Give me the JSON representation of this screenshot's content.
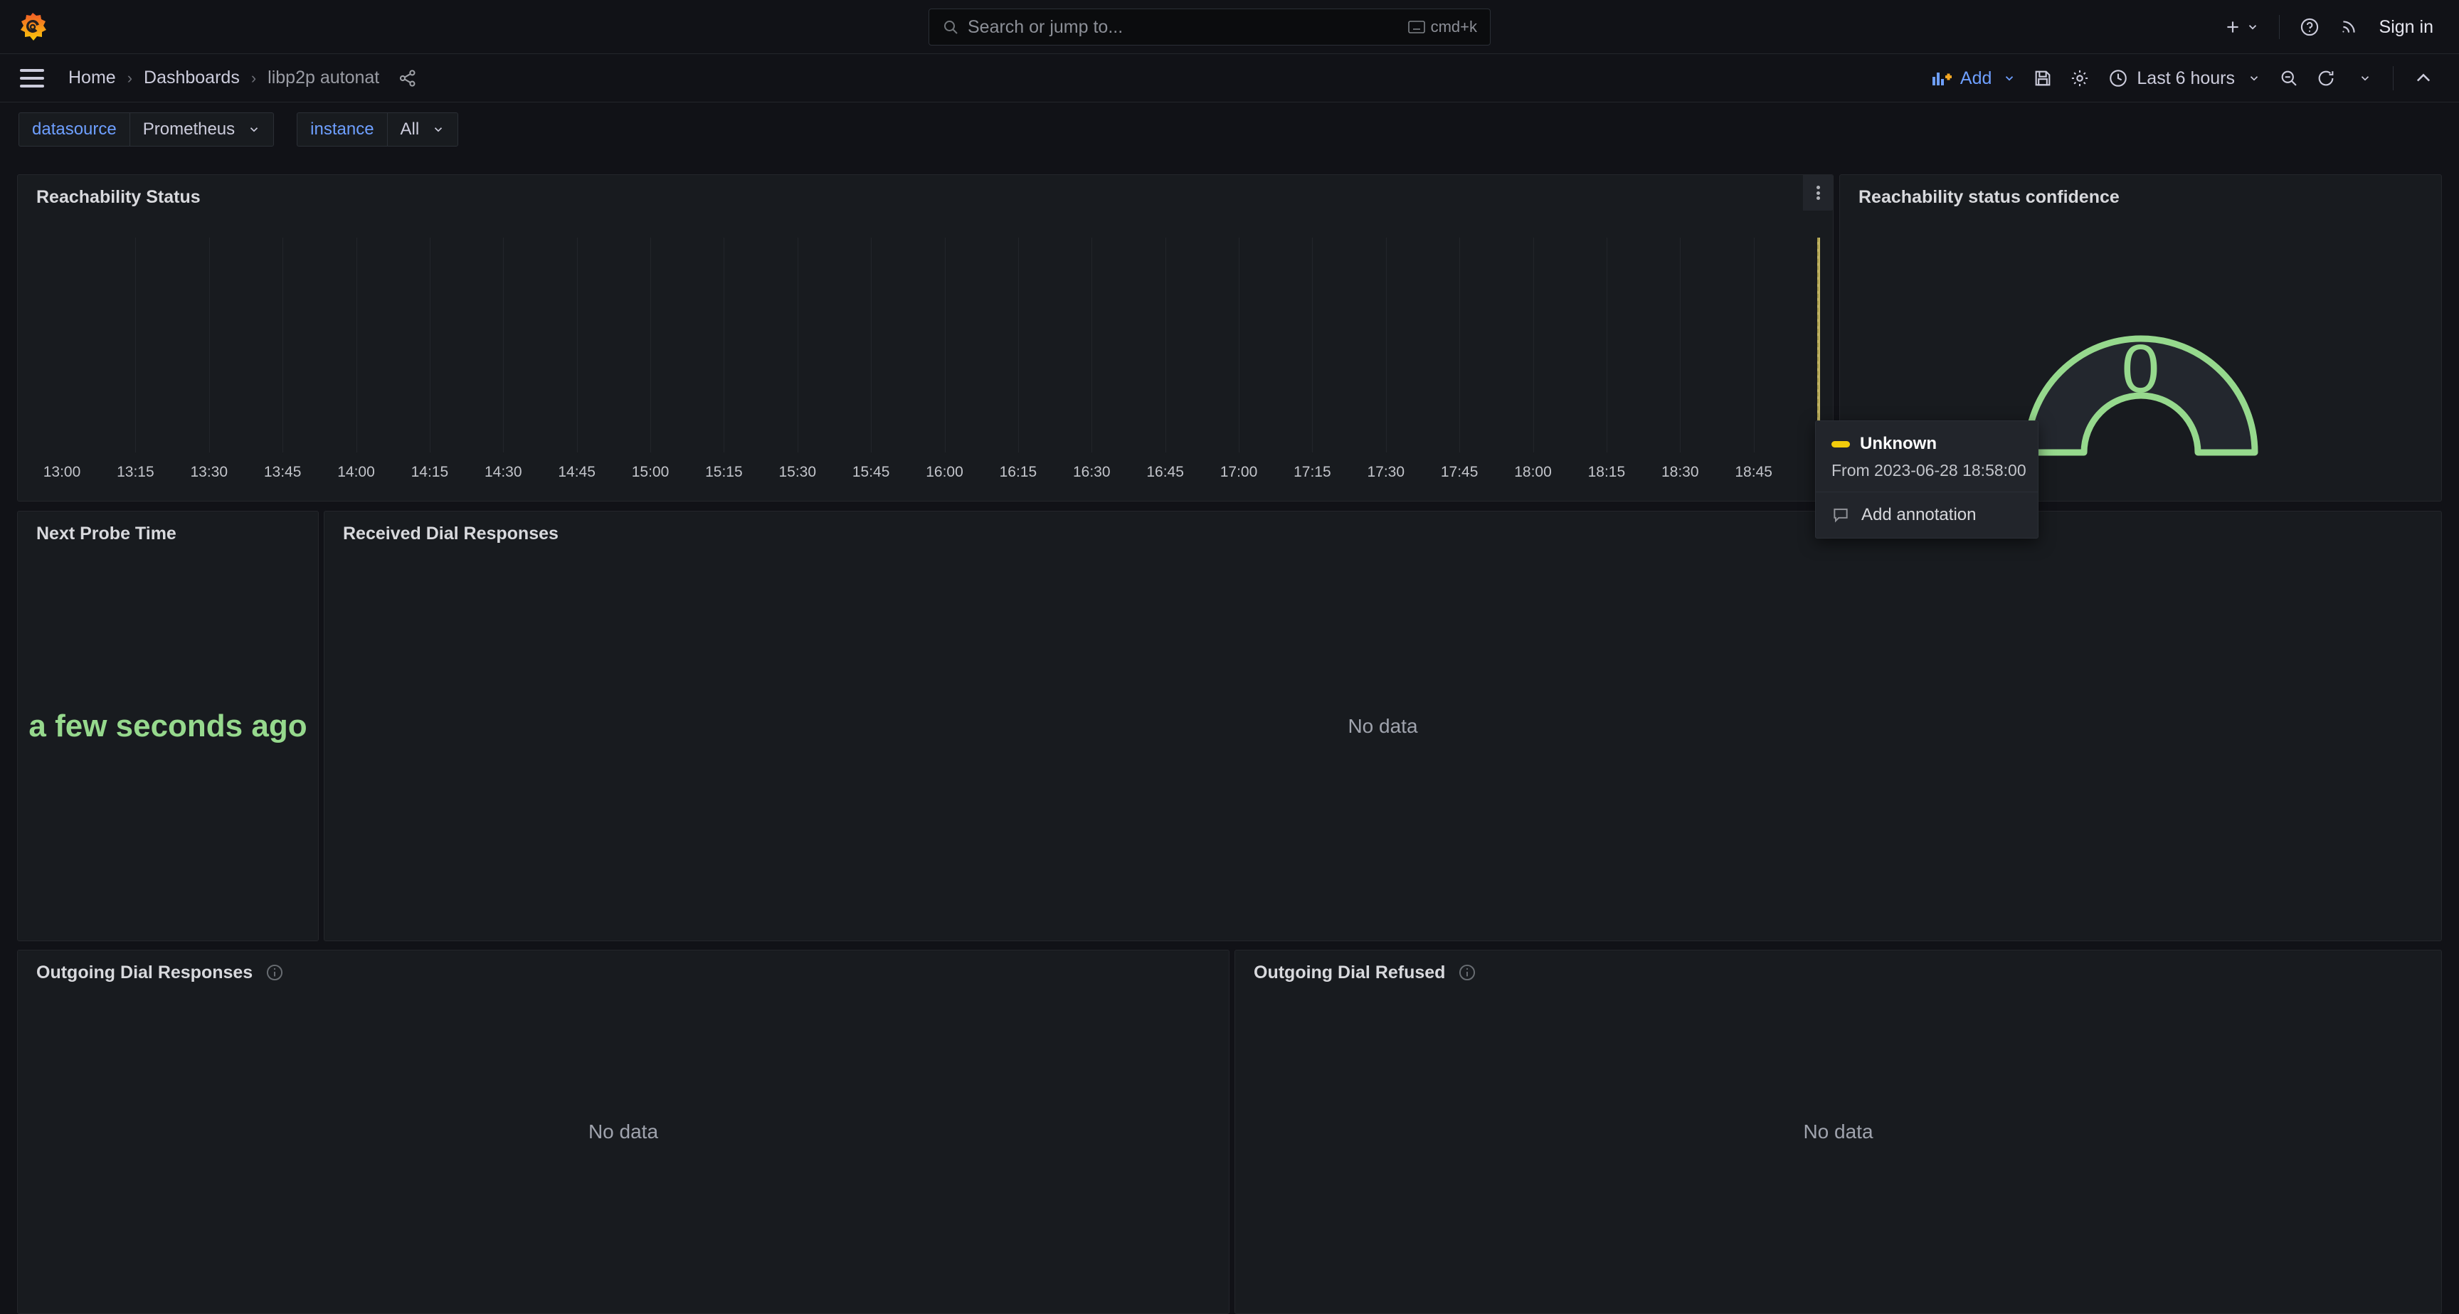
{
  "topbar": {
    "logo_name": "grafana-logo",
    "search": {
      "placeholder": "Search or jump to...",
      "shortcut": "cmd+k"
    },
    "add_new_label": "",
    "help_label": "",
    "news_label": "",
    "signin_label": "Sign in"
  },
  "subnav": {
    "breadcrumb": [
      {
        "label": "Home",
        "current": false
      },
      {
        "label": "Dashboards",
        "current": false
      },
      {
        "label": "libp2p autonat",
        "current": true
      }
    ],
    "breadcrumb_separator": "›",
    "add_label": "Add",
    "time_range_label": "Last 6 hours"
  },
  "variables": [
    {
      "name": "datasource",
      "value": "Prometheus"
    },
    {
      "name": "instance",
      "value": "All"
    }
  ],
  "panels": {
    "reachability_status": {
      "title": "Reachability Status",
      "time_ticks": [
        "13:00",
        "13:15",
        "13:30",
        "13:45",
        "14:00",
        "14:15",
        "14:30",
        "14:45",
        "15:00",
        "15:15",
        "15:30",
        "15:45",
        "16:00",
        "16:15",
        "16:30",
        "16:45",
        "17:00",
        "17:15",
        "17:30",
        "17:45",
        "18:00",
        "18:15",
        "18:30",
        "18:45"
      ],
      "region_color": "#cfc069"
    },
    "reachability_confidence": {
      "title": "Reachability status confidence",
      "value": "0",
      "color": "#96d98d"
    },
    "next_probe_time": {
      "title": "Next Probe Time",
      "value": "a few seconds ago",
      "color": "#96d98d"
    },
    "received_dial_responses": {
      "title": "Received Dial Responses",
      "nodata": "No data"
    },
    "outgoing_dial_responses": {
      "title": "Outgoing Dial Responses",
      "nodata": "No data"
    },
    "outgoing_dial_refused": {
      "title": "Outgoing Dial Refused",
      "nodata": "No data"
    }
  },
  "annotation_tooltip": {
    "title": "Unknown",
    "from_text": "From 2023-06-28 18:58:00",
    "action_label": "Add annotation",
    "swatch_color": "#f2cc0c"
  },
  "chart_data": {
    "type": "heatmap",
    "title": "Reachability Status",
    "xlabel": "",
    "ylabel": "",
    "x_ticks": [
      "13:00",
      "13:15",
      "13:30",
      "13:45",
      "14:00",
      "14:15",
      "14:30",
      "14:45",
      "15:00",
      "15:15",
      "15:30",
      "15:45",
      "16:00",
      "16:15",
      "16:30",
      "16:45",
      "17:00",
      "17:15",
      "17:30",
      "17:45",
      "18:00",
      "18:15",
      "18:30",
      "18:45"
    ],
    "xlim": [
      "13:00",
      "19:00"
    ],
    "grid": true,
    "legend": [
      "Unknown"
    ],
    "series": [
      {
        "name": "Unknown",
        "color": "#cfc069",
        "from": "2023-06-28 18:58:00",
        "values": [
          1
        ]
      }
    ],
    "gauges": [
      {
        "name": "Reachability status confidence",
        "type": "gauge",
        "value": 0,
        "min": 0,
        "max": 100,
        "color": "#96d98d"
      }
    ]
  }
}
